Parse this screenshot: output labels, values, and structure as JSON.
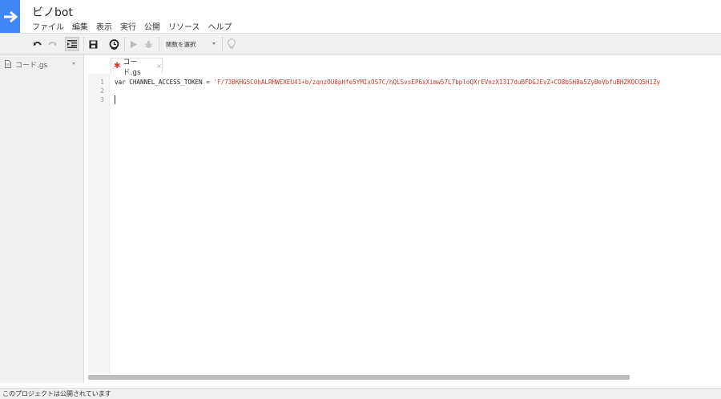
{
  "project": {
    "title": "ビノbot"
  },
  "menu": [
    "ファイル",
    "編集",
    "表示",
    "実行",
    "公開",
    "リソース",
    "ヘルプ"
  ],
  "toolbar": {
    "function_select": "関数を選択"
  },
  "sidebar": {
    "files": [
      {
        "name": "コード.gs"
      }
    ]
  },
  "editor": {
    "tab": {
      "name": "コード.gs",
      "modified_marker": "✱",
      "close": "×"
    },
    "line_numbers": [
      "1",
      "2",
      "3"
    ],
    "code_keyword": "var CHANNEL_ACCESS_TOKEN = ",
    "code_string": "'F/738KHG5C0hALRHWEXEU41+b/zqnzOU8pHfe5YMIxOS7C/hQLSvsEP6xXimw57L7bploQXrEVnzXI3I7duBFDGJEvZ+CO8bSH8a5ZyBeVbfuBHZKOCQ5H1Zy"
  },
  "status": {
    "text": "このプロジェクトは公開されています"
  },
  "colors": {
    "accent": "#4285f4",
    "string": "#c0392b"
  }
}
